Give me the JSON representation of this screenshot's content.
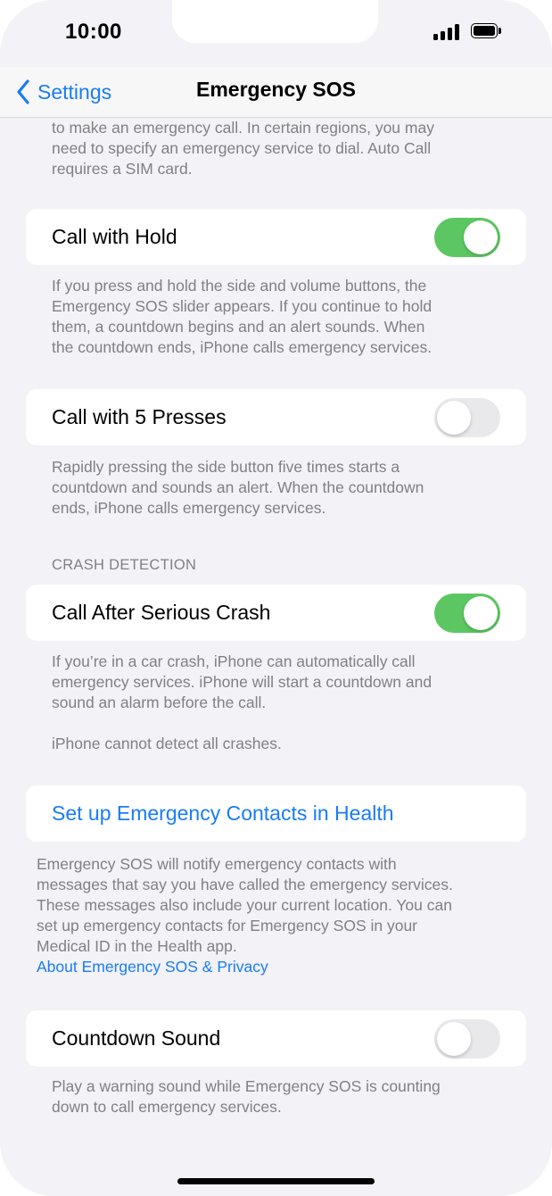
{
  "status_bar": {
    "time": "10:00"
  },
  "nav": {
    "back_label": "Settings",
    "title": "Emergency SOS"
  },
  "colors": {
    "accent": "#1a7cf5",
    "toggle_on": "#5cc762",
    "toggle_off": "#e9e9eb",
    "background": "#f2f2f7"
  },
  "top_footer": {
    "lines": [
      "to make an emergency call. In certain regions, you may",
      "need to specify an emergency service to dial. Auto Call",
      "requires a SIM card."
    ]
  },
  "call_with_hold": {
    "label": "Call with Hold",
    "toggle_on": true,
    "footer_lines": [
      "If you press and hold the side and volume buttons, the",
      "Emergency SOS slider appears. If you continue to hold",
      "them, a countdown begins and an alert sounds. When",
      "the countdown ends, iPhone calls emergency services."
    ]
  },
  "call_with_presses": {
    "label": "Call with 5 Presses",
    "toggle_on": false,
    "footer_lines": [
      "Rapidly pressing the side button five times starts a",
      "countdown and sounds an alert. When the countdown",
      "ends, iPhone calls emergency services."
    ]
  },
  "crash_detection": {
    "header": "CRASH DETECTION",
    "label": "Call After Serious Crash",
    "toggle_on": true,
    "footer_lines": [
      "If you’re in a car crash, iPhone can automatically call",
      "emergency services. iPhone will start a countdown and",
      "sound an alarm before the call."
    ],
    "note": "iPhone cannot detect all crashes."
  },
  "emergency_contacts": {
    "link_label": "Set up Emergency Contacts in Health",
    "footer_lines": [
      "Emergency SOS will notify emergency contacts with",
      "messages that say you have called the emergency services.",
      "These messages also include your current location. You can",
      "set up emergency contacts for Emergency SOS in your",
      "Medical ID in the Health app."
    ],
    "privacy_link": "About Emergency SOS & Privacy"
  },
  "countdown_sound": {
    "label": "Countdown Sound",
    "toggle_on": false,
    "footer_lines": [
      "Play a warning sound while Emergency SOS is counting",
      "down to call emergency services."
    ]
  },
  "icons": {
    "back": "chevron-left-icon",
    "signal": "cellular-signal-icon",
    "battery": "battery-icon"
  }
}
